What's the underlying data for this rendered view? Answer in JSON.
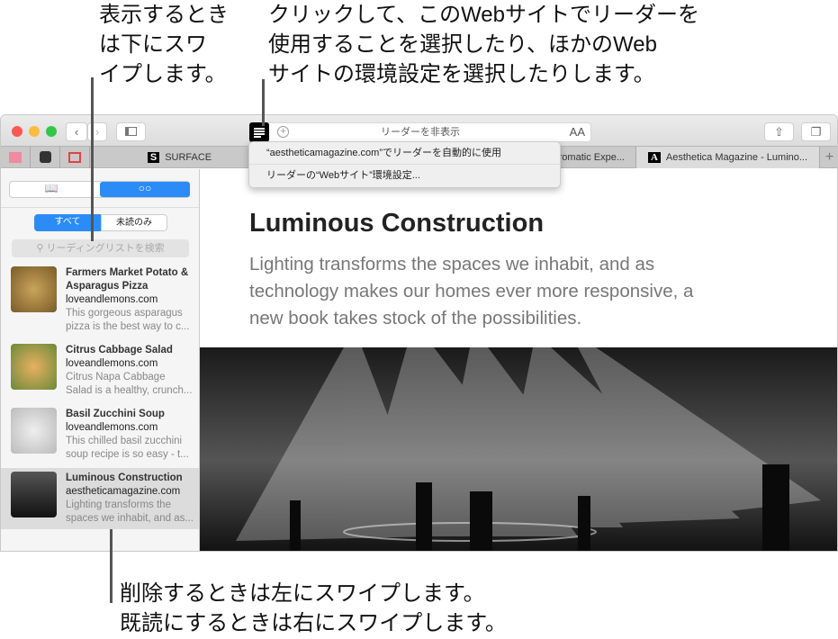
{
  "callouts": {
    "top_left": [
      "表示するとき",
      "は下にスワ",
      "イプします。"
    ],
    "top_right": [
      "クリックして、このWebサイトでリーダーを",
      "使用することを選択したり、ほかのWeb",
      "サイトの環境設定を選択したりします。"
    ],
    "bottom": [
      "削除するときは左にスワイプします。",
      "既読にするときは右にスワイプします。"
    ]
  },
  "toolbar": {
    "address_text": "リーダーを非表示",
    "text_size_label": "AA"
  },
  "tabs": [
    {
      "label": "SURFACE",
      "favicon": "S"
    },
    {
      "label": "hromatic Expe..."
    },
    {
      "label": "Aesthetica Magazine - Lumino...",
      "favicon": "A"
    }
  ],
  "reader_menu": {
    "items": [
      "“aestheticamagazine.com”でリーダーを自動的に使用",
      "リーダーの“Webサイト”環境設定..."
    ]
  },
  "sidebar": {
    "filter": {
      "all": "すべて",
      "unread": "未読のみ"
    },
    "search_placeholder": "リーディングリストを検索",
    "items": [
      {
        "title": [
          "Farmers Market Potato &",
          "Asparagus Pizza"
        ],
        "site": "loveandlemons.com",
        "desc": [
          "This gorgeous asparagus",
          "pizza is the best way to c..."
        ]
      },
      {
        "title": [
          "Citrus Cabbage Salad"
        ],
        "site": "loveandlemons.com",
        "desc": [
          "Citrus Napa Cabbage",
          "Salad is a healthy, crunch..."
        ]
      },
      {
        "title": [
          "Basil Zucchini Soup"
        ],
        "site": "loveandlemons.com",
        "desc": [
          "This chilled basil zucchini",
          "soup recipe is so easy - t..."
        ]
      },
      {
        "title": [
          "Luminous Construction"
        ],
        "site": "aestheticamagazine.com",
        "desc": [
          "Lighting transforms the",
          "spaces we inhabit, and as..."
        ]
      }
    ]
  },
  "article": {
    "title": "Luminous Construction",
    "subtitle": [
      "Lighting transforms the spaces we inhabit, and as",
      "technology makes our homes ever more responsive, a",
      "new book takes stock of the possibilities."
    ]
  },
  "colors": {
    "accent": "#1a82fb",
    "selected_row": "#dcdcdc"
  }
}
